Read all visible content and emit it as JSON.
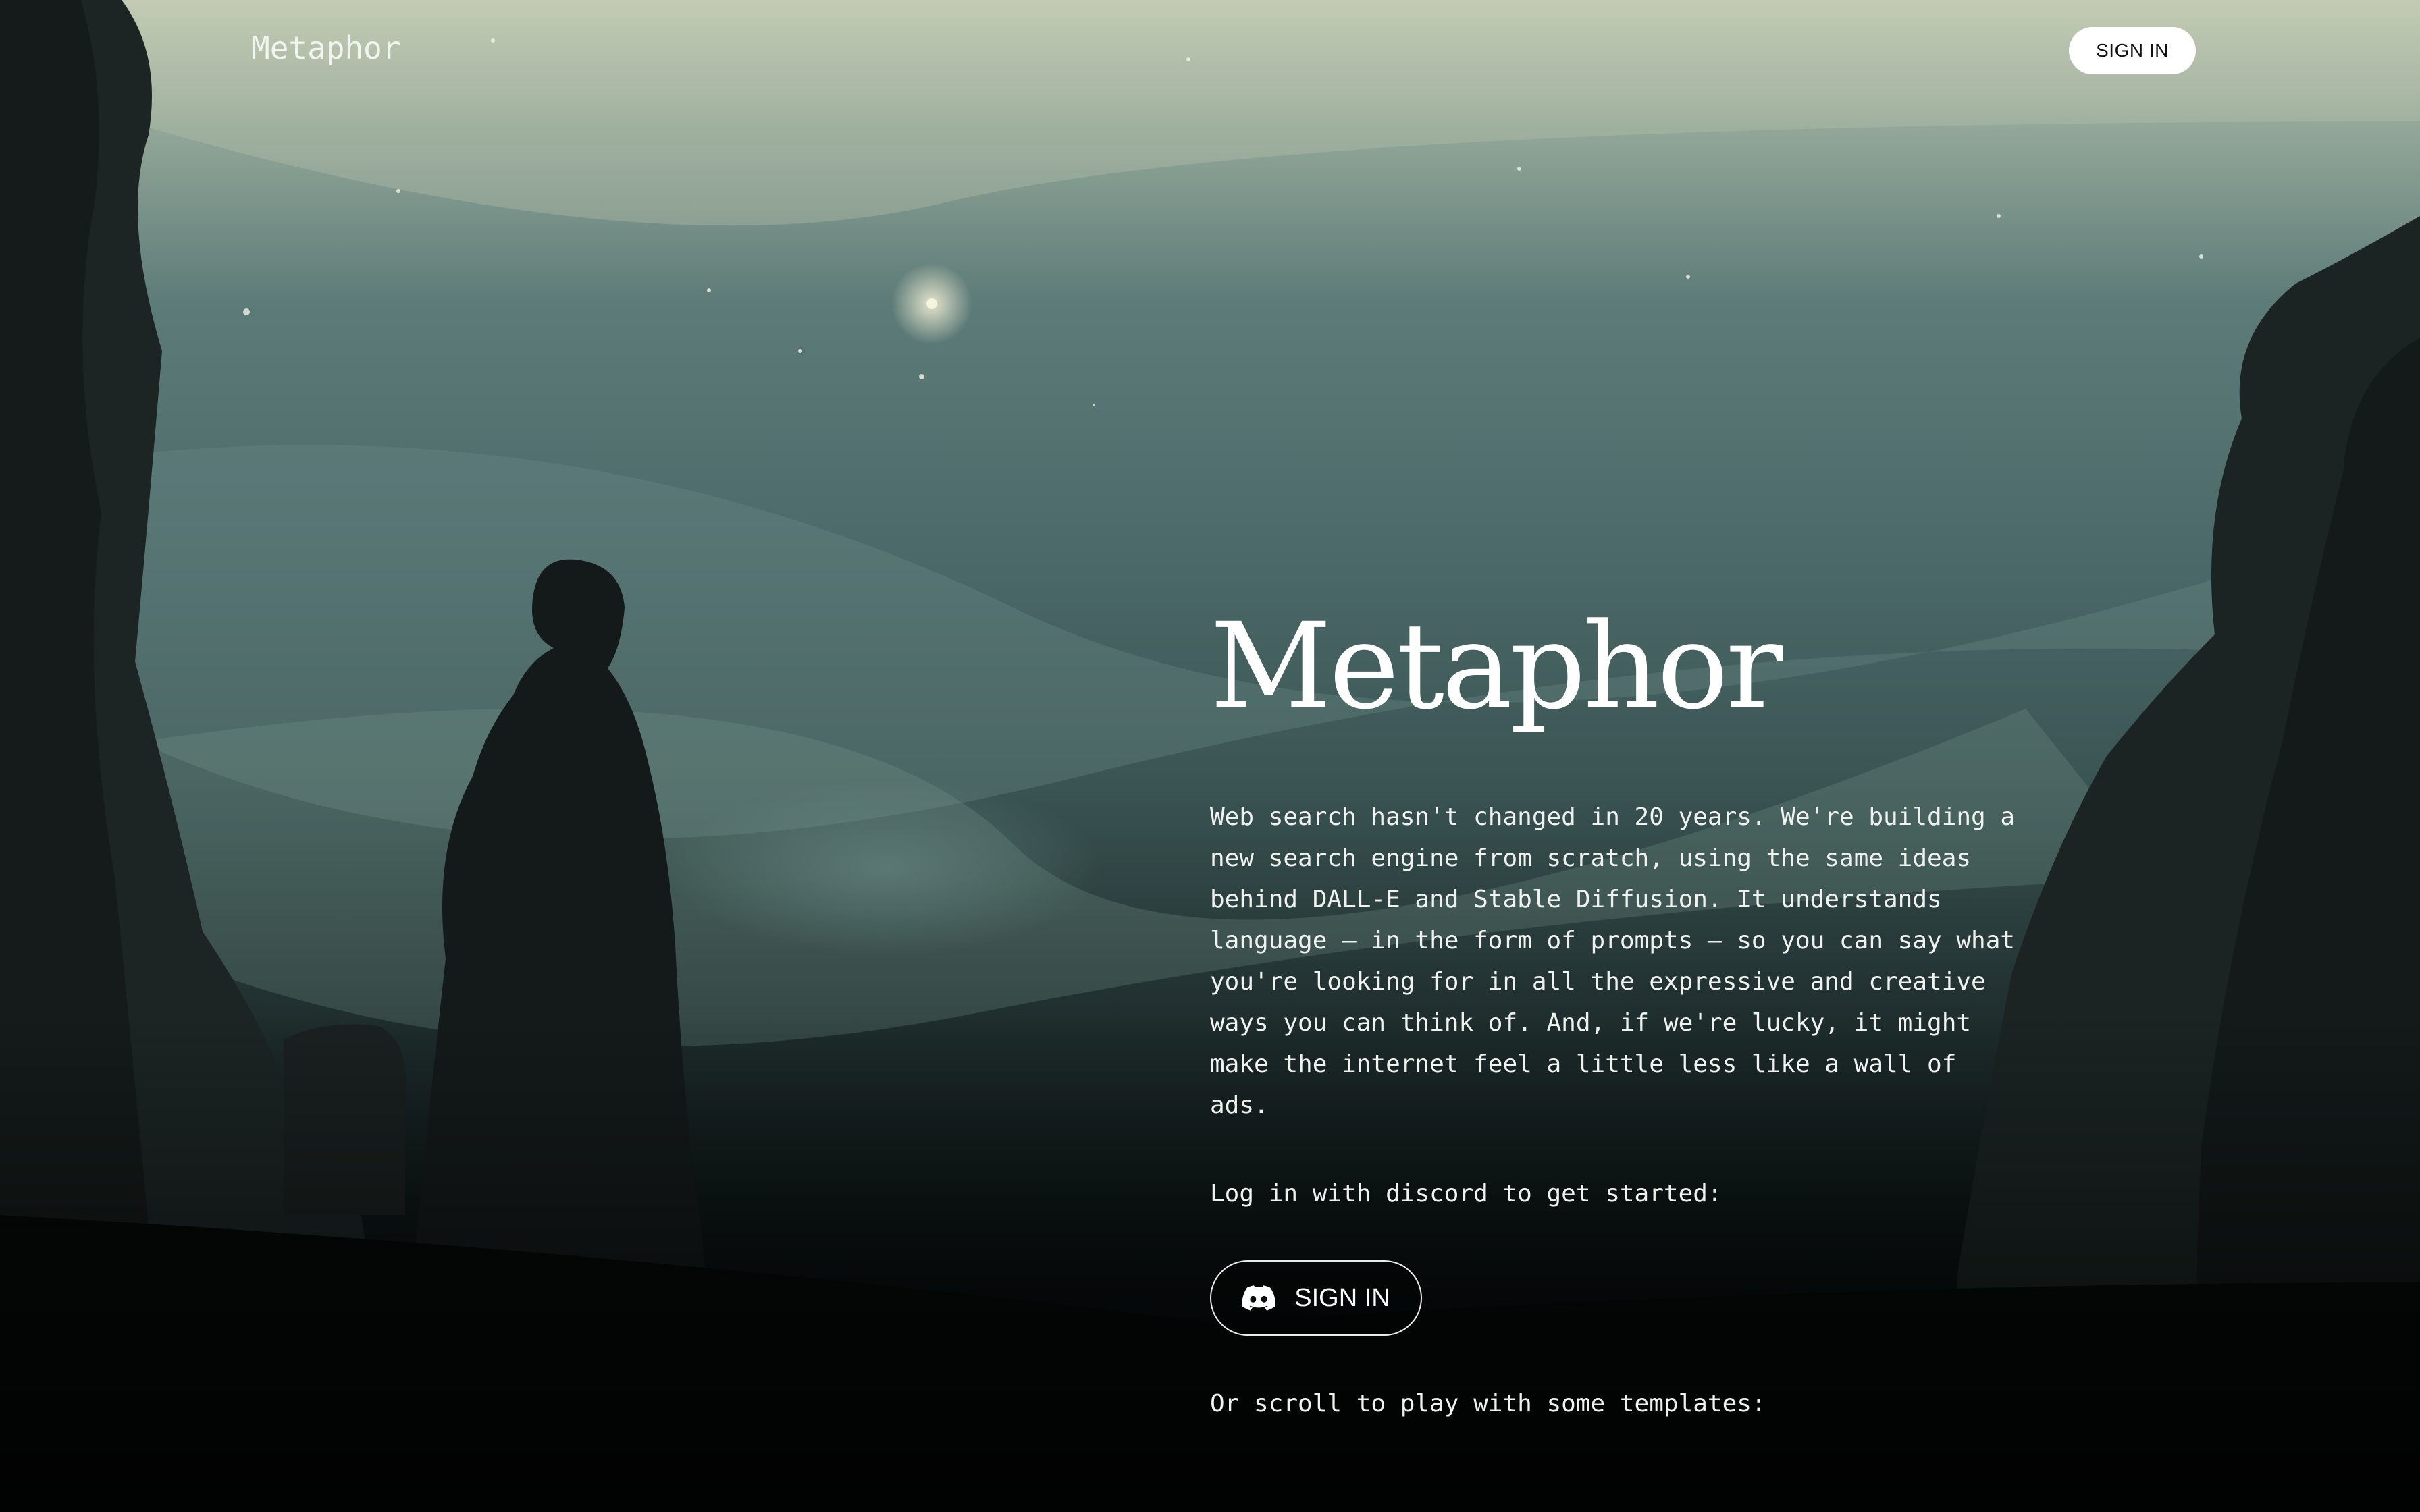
{
  "header": {
    "logo": "Metaphor",
    "signin_label": "SIGN IN"
  },
  "hero": {
    "title": "Metaphor",
    "description": "Web search hasn't changed in 20 years. We're building a new search engine from scratch, using the same ideas behind DALL-E and Stable Diffusion. It understands language — in the form of prompts — so you can say what you're looking for in all the expressive and creative ways you can think of. And, if we're lucky, it might make the internet feel a little less like a wall of ads.",
    "login_prompt": "Log in with discord to get started:",
    "signin_label": "SIGN IN",
    "scroll_prompt": "Or scroll to play with some templates:"
  },
  "icons": {
    "discord": "discord-icon"
  },
  "colors": {
    "sky_top": "#c9d2b8",
    "sky_mid": "#4f6e6c",
    "ground": "#050707",
    "text": "#ffffff"
  }
}
